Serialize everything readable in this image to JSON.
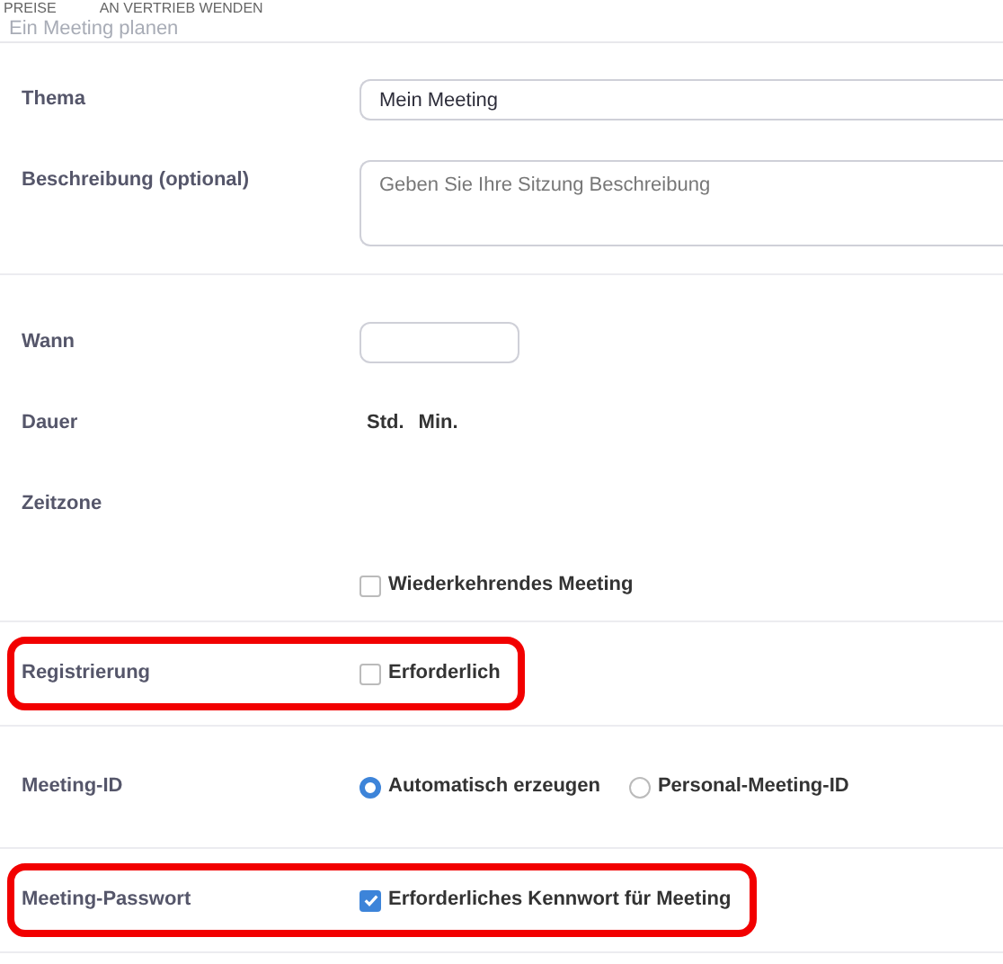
{
  "nav": [
    "PREISE",
    "AN VERTRIEB WENDEN"
  ],
  "page_title": "Ein Meeting planen",
  "sections": [
    {
      "highlighted": false,
      "rows": [
        {
          "label": "Thema",
          "kind": "text",
          "value": "Mein Meeting"
        },
        {
          "label": "Beschreibung (optional)",
          "kind": "textarea",
          "placeholder": "Geben Sie Ihre Sitzung Beschreibung"
        }
      ]
    },
    {
      "highlighted": false,
      "rows": [
        {
          "label": "Wann",
          "kind": "date"
        },
        {
          "label": "Dauer",
          "kind": "duration",
          "units": [
            "Std.",
            "Min."
          ]
        },
        {
          "label": "Zeitzone",
          "kind": "none"
        },
        {
          "kind": "checkbox",
          "text": "Wiederkehrendes Meeting",
          "checked": false
        }
      ]
    },
    {
      "highlighted": true,
      "rows": [
        {
          "label": "Registrierung",
          "kind": "checkbox",
          "text": "Erforderlich",
          "checked": false
        }
      ]
    },
    {
      "highlighted": false,
      "rows": [
        {
          "label": "Meeting-ID",
          "kind": "radio",
          "options": [
            {
              "text": "Automatisch erzeugen",
              "selected": true
            },
            {
              "text": "Personal-Meeting-ID",
              "selected": false
            }
          ]
        }
      ]
    },
    {
      "highlighted": true,
      "rows": [
        {
          "label": "Meeting-Passwort",
          "kind": "checkbox",
          "text": "Erforderliches Kennwort für Meeting",
          "checked": true
        }
      ]
    }
  ]
}
